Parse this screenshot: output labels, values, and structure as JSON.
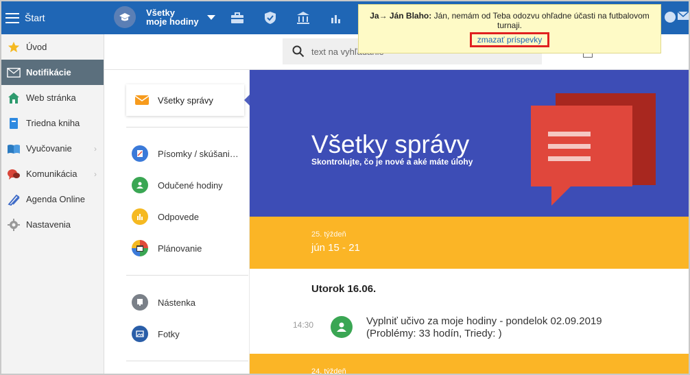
{
  "app": {
    "start_label": "Štart"
  },
  "course": {
    "line1": "Všetky",
    "line2": "moje hodiny"
  },
  "toast": {
    "sender": "Ja→ Ján Blaho:",
    "message": "Ján, nemám od Teba odozvu ohľadne účasti na futbalovom turnaji.",
    "delete_link": "zmazať príspevky"
  },
  "sidebar": {
    "items": [
      {
        "label": "Úvod",
        "icon": "star-icon"
      },
      {
        "label": "Notifikácie",
        "icon": "envelope-icon"
      },
      {
        "label": "Web stránka",
        "icon": "home-icon"
      },
      {
        "label": "Triedna kniha",
        "icon": "book-icon"
      },
      {
        "label": "Vyučovanie",
        "icon": "open-book-icon"
      },
      {
        "label": "Komunikácia",
        "icon": "chat-icon"
      },
      {
        "label": "Agenda Online",
        "icon": "pen-icon"
      },
      {
        "label": "Nastavenia",
        "icon": "gear-icon"
      }
    ]
  },
  "search": {
    "placeholder": "text na vyhľadanie"
  },
  "nav": {
    "active": "Všetky správy",
    "items": [
      {
        "label": "Písomky / skúšani…"
      },
      {
        "label": "Odučené hodiny"
      },
      {
        "label": "Odpovede"
      },
      {
        "label": "Plánovanie"
      },
      {
        "label": "Nástenka"
      },
      {
        "label": "Fotky"
      }
    ]
  },
  "hero": {
    "title": "Všetky správy",
    "subtitle": "Skontrolujte, čo je nové a aké máte úlohy"
  },
  "week": {
    "label": "25. týždeň",
    "range": "jún 15 - 21"
  },
  "entry": {
    "day": "Utorok 16.06.",
    "time": "14:30",
    "line1": "Vyplniť učivo za moje hodiny - pondelok 02.09.2019",
    "line2": "(Problémy: 33 hodín, Triedy: )"
  },
  "week2": {
    "label": "24. týždeň"
  },
  "colors": {
    "topbar": "#1f66b5",
    "hero": "#3d4db6",
    "week": "#fbb526",
    "active_sidebar": "#5b6f7d"
  }
}
